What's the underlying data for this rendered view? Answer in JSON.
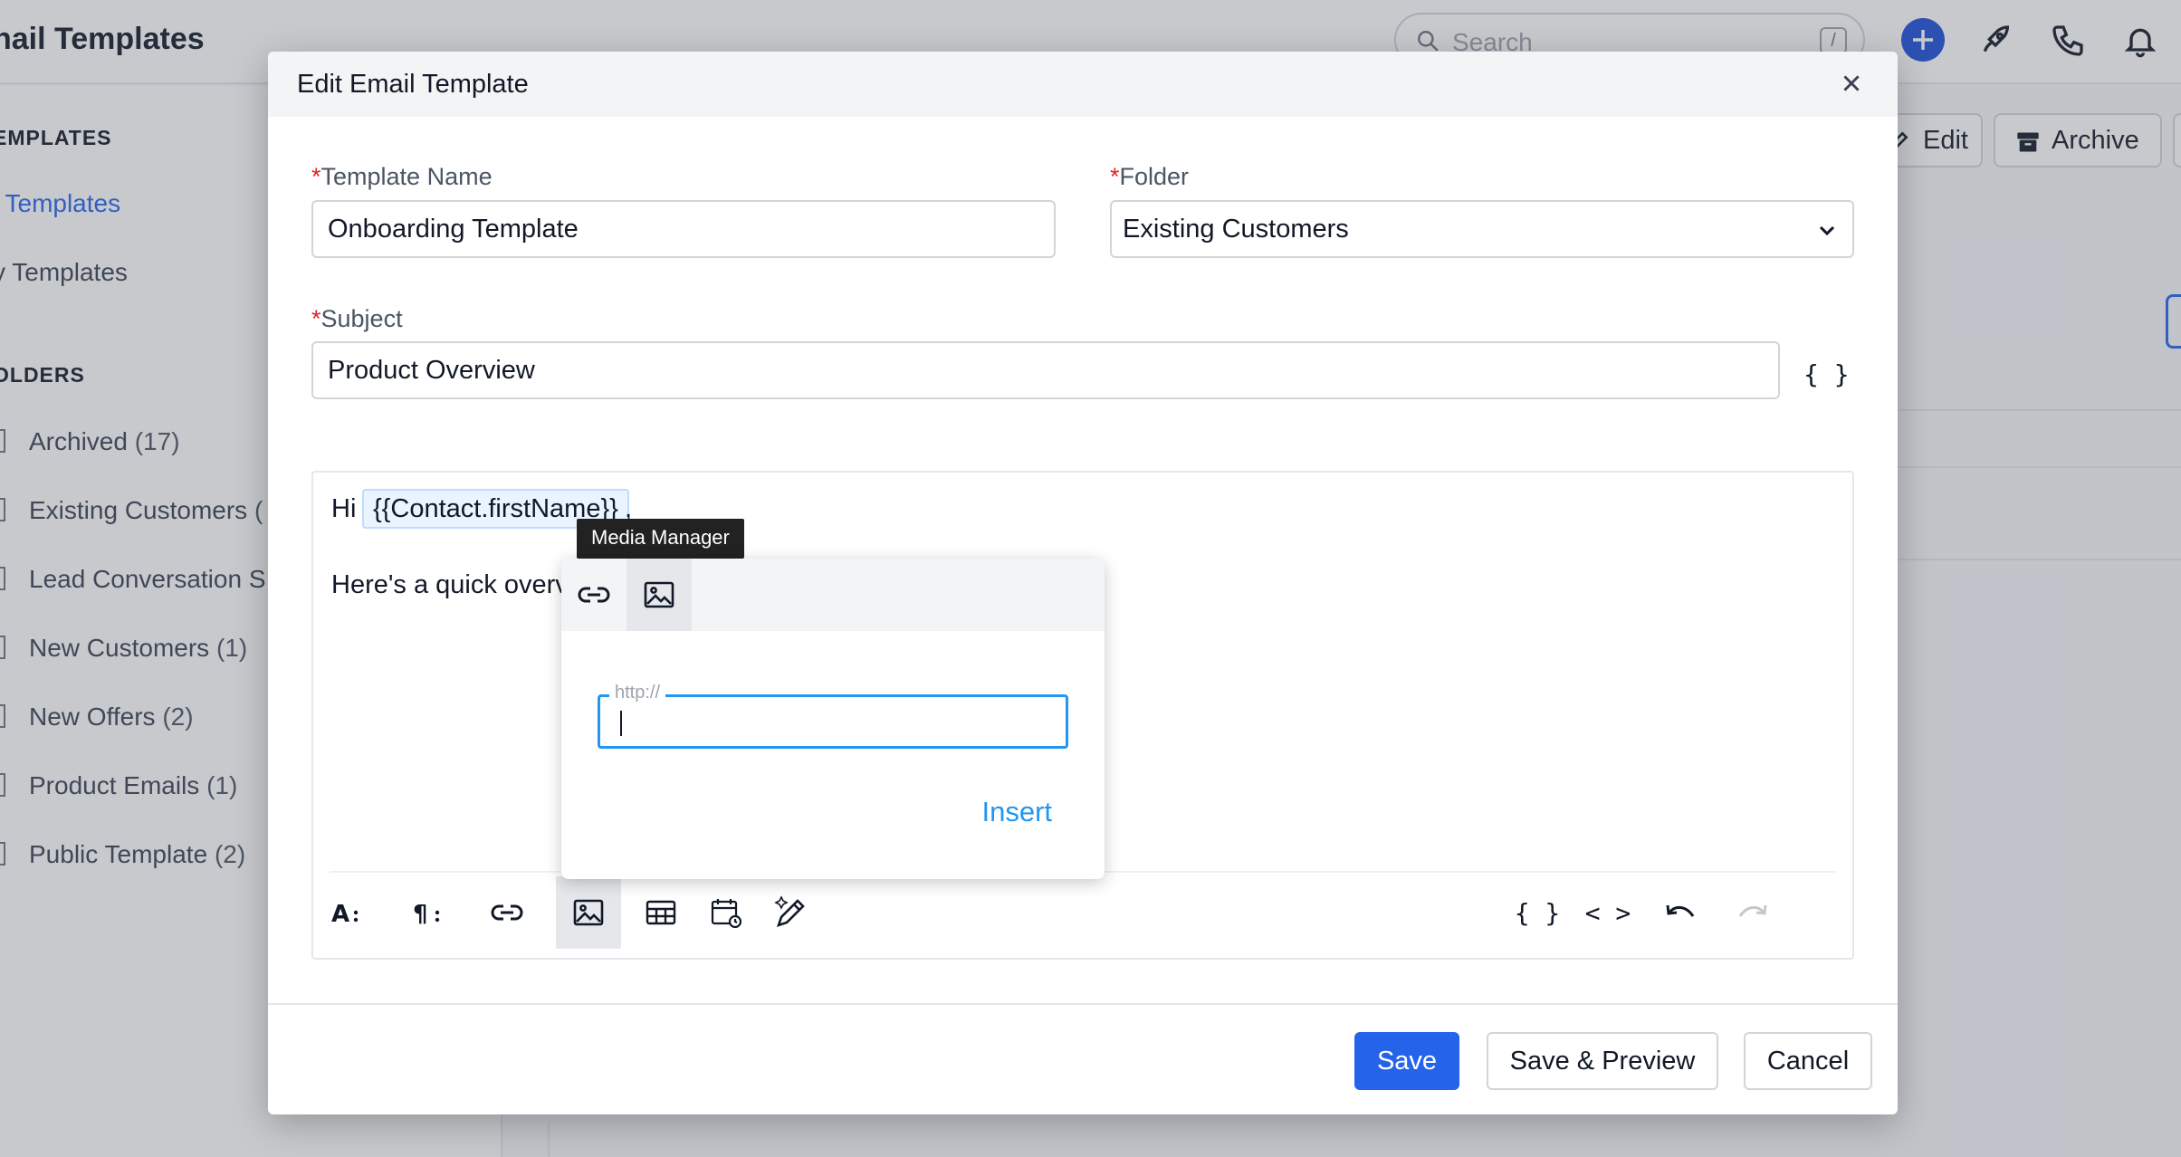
{
  "app": {
    "title": "nail Templates",
    "search_placeholder": "Search",
    "search_shortcut": "/"
  },
  "sidebar": {
    "templates_heading": "EMPLATES",
    "links": [
      {
        "label": "l Templates",
        "active": true
      },
      {
        "label": "y Templates",
        "active": false
      }
    ],
    "folders_heading": "OLDERS",
    "folders": [
      {
        "name": "Archived",
        "count": "(17)"
      },
      {
        "name": "Existing Customers",
        "count": "("
      },
      {
        "name": "Lead Conversation S",
        "count": ""
      },
      {
        "name": "New Customers",
        "count": "(1)"
      },
      {
        "name": "New Offers",
        "count": "(2)"
      },
      {
        "name": "Product Emails",
        "count": "(1)"
      },
      {
        "name": "Public Template",
        "count": "(2)"
      }
    ]
  },
  "background_actions": {
    "edit_label": "Edit",
    "archive_label": "Archive"
  },
  "modal": {
    "title": "Edit Email Template",
    "template_name_label": "Template Name",
    "template_name_value": "Onboarding Template",
    "folder_label": "Folder",
    "folder_value": "Existing Customers",
    "subject_label": "Subject",
    "subject_value": "Product Overview",
    "required_mark": "*",
    "curly_label": "{ }",
    "editor": {
      "greeting": "Hi",
      "merge_tag": "{{Contact.firstName}}",
      "comma": ",",
      "body_line": "Here's a quick overv"
    },
    "toolbar_code_labels": {
      "merge_fields": "{ }",
      "source_code": "< >"
    },
    "footer": {
      "save": "Save",
      "save_preview": "Save & Preview",
      "cancel": "Cancel"
    }
  },
  "media_popup": {
    "tooltip": "Media Manager",
    "url_legend": "http://",
    "url_value": "",
    "insert_label": "Insert"
  },
  "colors": {
    "primary": "#2563eb",
    "popup_accent": "#2196f3",
    "required": "#dc2626",
    "merge_tag_bg": "#eaf4ff"
  }
}
